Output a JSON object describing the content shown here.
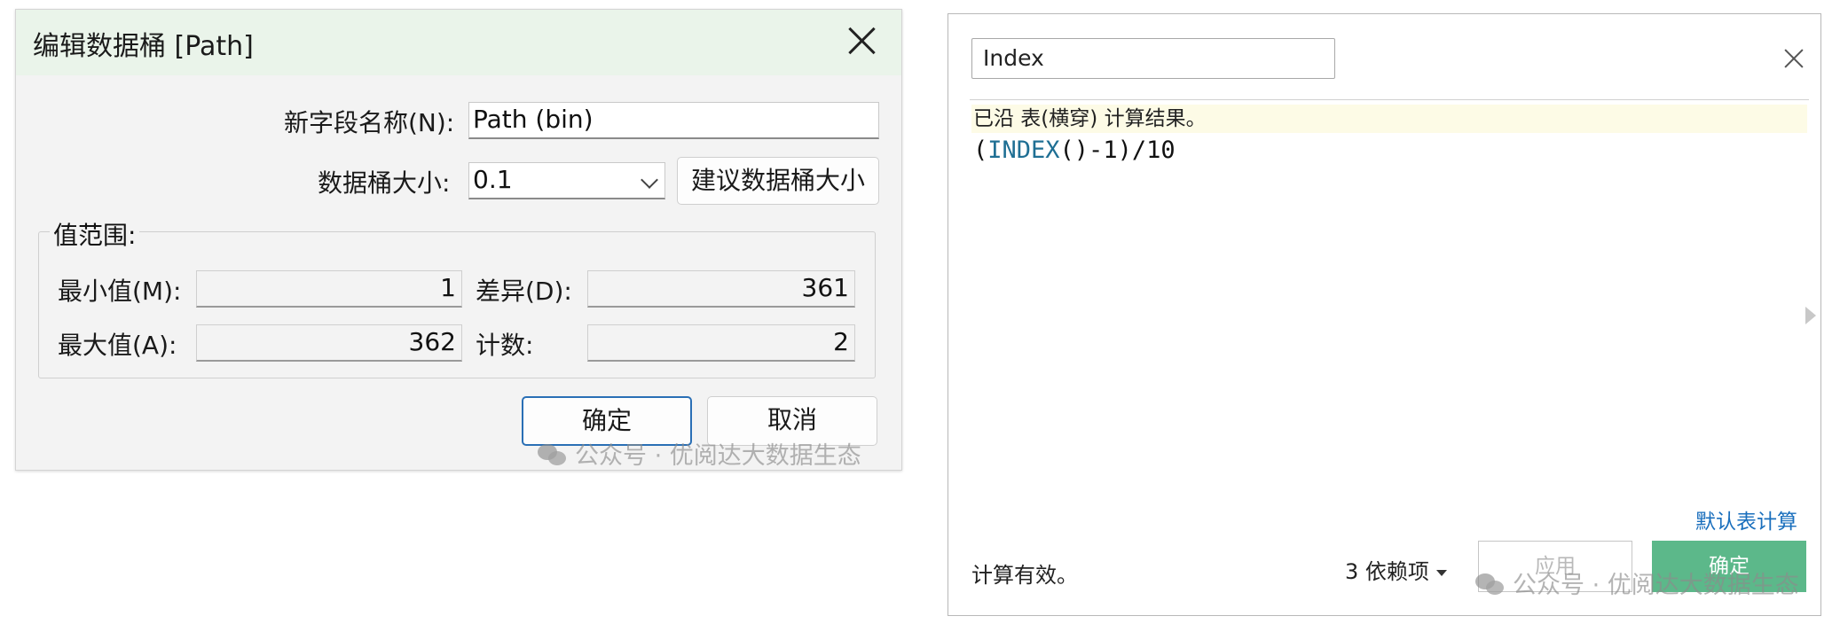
{
  "bin_dialog": {
    "title": "编辑数据桶 [Path]",
    "new_field_label": "新字段名称(N):",
    "new_field_value": "Path (bin)",
    "bin_size_label": "数据桶大小:",
    "bin_size_value": "0.1",
    "suggest_button": "建议数据桶大小",
    "range_group_title": "值范围:",
    "min_label": "最小值(M):",
    "min_value": "1",
    "diff_label": "差异(D):",
    "diff_value": "361",
    "max_label": "最大值(A):",
    "max_value": "362",
    "count_label": "计数:",
    "count_value": "2",
    "ok_button": "确定",
    "cancel_button": "取消"
  },
  "calc_editor": {
    "name_value": "Index",
    "compute_note": "已沿 表(横穿) 计算结果。",
    "formula_open": "(",
    "formula_fn": "INDEX",
    "formula_rest": "()-1)/10",
    "default_table_calc_link": "默认表计算",
    "status": "计算有效。",
    "dependencies": "3 依赖项",
    "apply_button": "应用",
    "ok_button": "确定"
  },
  "watermark": {
    "left": "公众号 · 优阅达大数据生态",
    "right": "公众号 · 优阅达大数据生态"
  },
  "colors": {
    "title_bar": "#eaf4ea",
    "primary_border": "#2a6fb5",
    "formula_function": "#1f6f94",
    "link": "#1a6fbd",
    "ok_green": "#5cb88a",
    "note_bg": "#fdfbe6"
  },
  "icons": {
    "dialog_close": "close-icon",
    "combo_arrow": "chevron-down-icon",
    "calc_close": "close-icon",
    "dependencies_caret": "caret-down-icon",
    "side_panel_toggle": "triangle-right-icon",
    "watermark_logo": "wechat-icon"
  }
}
